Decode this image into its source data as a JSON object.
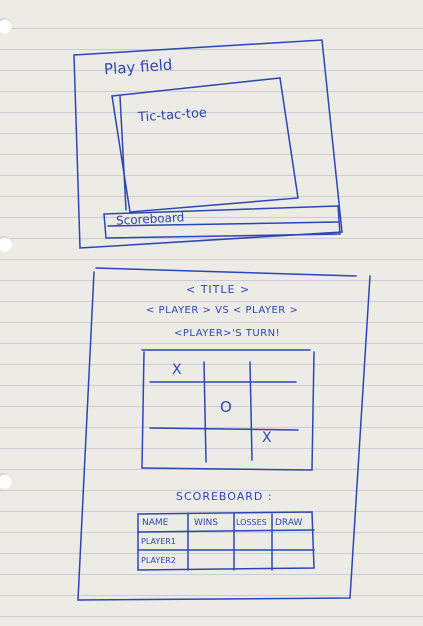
{
  "sketch_top": {
    "playfield_label": "Play field",
    "game_label": "Tic-tac-toe",
    "scoreboard_label": "Scoreboard"
  },
  "sketch_bottom": {
    "title": "< TITLE >",
    "versus": "< PLAYER > VS < PLAYER >",
    "turn": "<PLAYER>'S TURN!",
    "board": [
      [
        "X",
        "",
        ""
      ],
      [
        "",
        "O",
        ""
      ],
      [
        "",
        "",
        "X"
      ]
    ],
    "scoreboard_heading": "SCOREBOARD :",
    "table": {
      "headers": [
        "NAME",
        "WINS",
        "LOSSES",
        "DRAW"
      ],
      "rows": [
        [
          "PLAYER1",
          "",
          "",
          ""
        ],
        [
          "PLAYER2",
          "",
          "",
          ""
        ]
      ]
    }
  },
  "colors": {
    "ink": "#2c46b4",
    "paper": "#ecebe6",
    "rule": "#c9cdd3"
  }
}
